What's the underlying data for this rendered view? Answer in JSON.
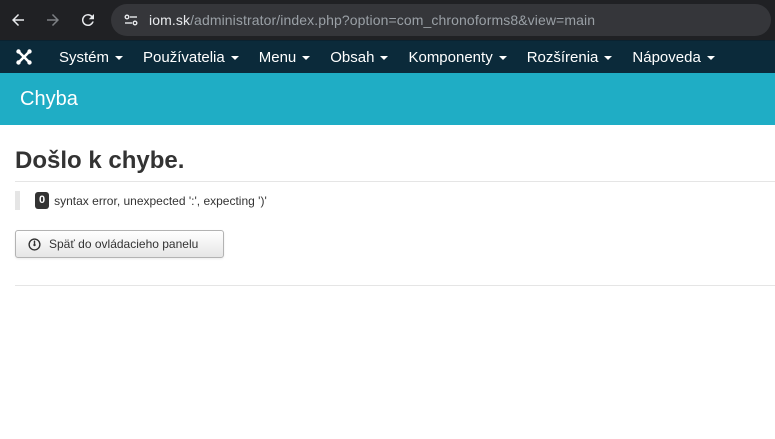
{
  "browser": {
    "url_host": "iom.sk",
    "url_path": "/administrator/index.php?option=com_chronoforms8&view=main"
  },
  "navbar": {
    "brand_icon": "joomla-icon",
    "items": [
      {
        "label": "Systém"
      },
      {
        "label": "Používatelia"
      },
      {
        "label": "Menu"
      },
      {
        "label": "Obsah"
      },
      {
        "label": "Komponenty"
      },
      {
        "label": "Rozšírenia"
      },
      {
        "label": "Nápoveda"
      }
    ]
  },
  "subhead": {
    "title": "Chyba"
  },
  "main": {
    "error_title": "Došlo k chybe.",
    "error_code": "0",
    "error_message": "syntax error, unexpected ':', expecting ')'",
    "back_button_label": "Späť do ovládacieho panelu",
    "back_button_icon": "dashboard-icon"
  },
  "colors": {
    "navbar_bg": "#0b2a3a",
    "subhead_bg": "#1fadc5",
    "browser_bg": "#202124"
  }
}
